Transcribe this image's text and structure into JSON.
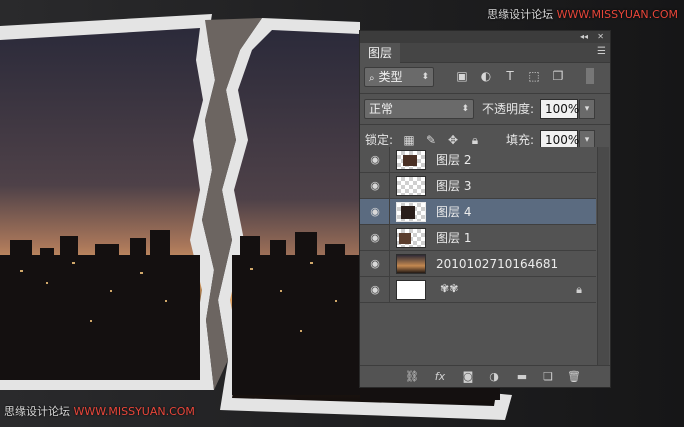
{
  "watermark": {
    "top_label": "思缘设计论坛",
    "top_url": "WWW.MISSYUAN.COM",
    "bottom_label": "思缘设计论坛",
    "bottom_url": "WWW.MISSYUAN.COM"
  },
  "panel": {
    "tab_label": "图层",
    "filter": {
      "label": "类型"
    },
    "blend_mode": "正常",
    "opacity_label": "不透明度:",
    "opacity_value": "100%",
    "lock_label": "锁定:",
    "fill_label": "填充:",
    "fill_value": "100%",
    "layers": [
      {
        "name": "图层 2",
        "visible": true,
        "selected": false,
        "thumb": "photo-piece-checker"
      },
      {
        "name": "图层 3",
        "visible": true,
        "selected": false,
        "thumb": "checker"
      },
      {
        "name": "图层 4",
        "visible": true,
        "selected": true,
        "thumb": "photo-piece-checker"
      },
      {
        "name": "图层 1",
        "visible": true,
        "selected": false,
        "thumb": "photo-piece-checker"
      },
      {
        "name": "2010102710164681",
        "visible": true,
        "selected": false,
        "thumb": "photo"
      },
      {
        "name": "",
        "visible": true,
        "selected": false,
        "thumb": "white",
        "has_fx": true,
        "locked": true
      }
    ]
  },
  "colors": {
    "panel_bg": "#535353",
    "selected_row": "#5b6b80",
    "watermark_accent": "#e8463a"
  }
}
